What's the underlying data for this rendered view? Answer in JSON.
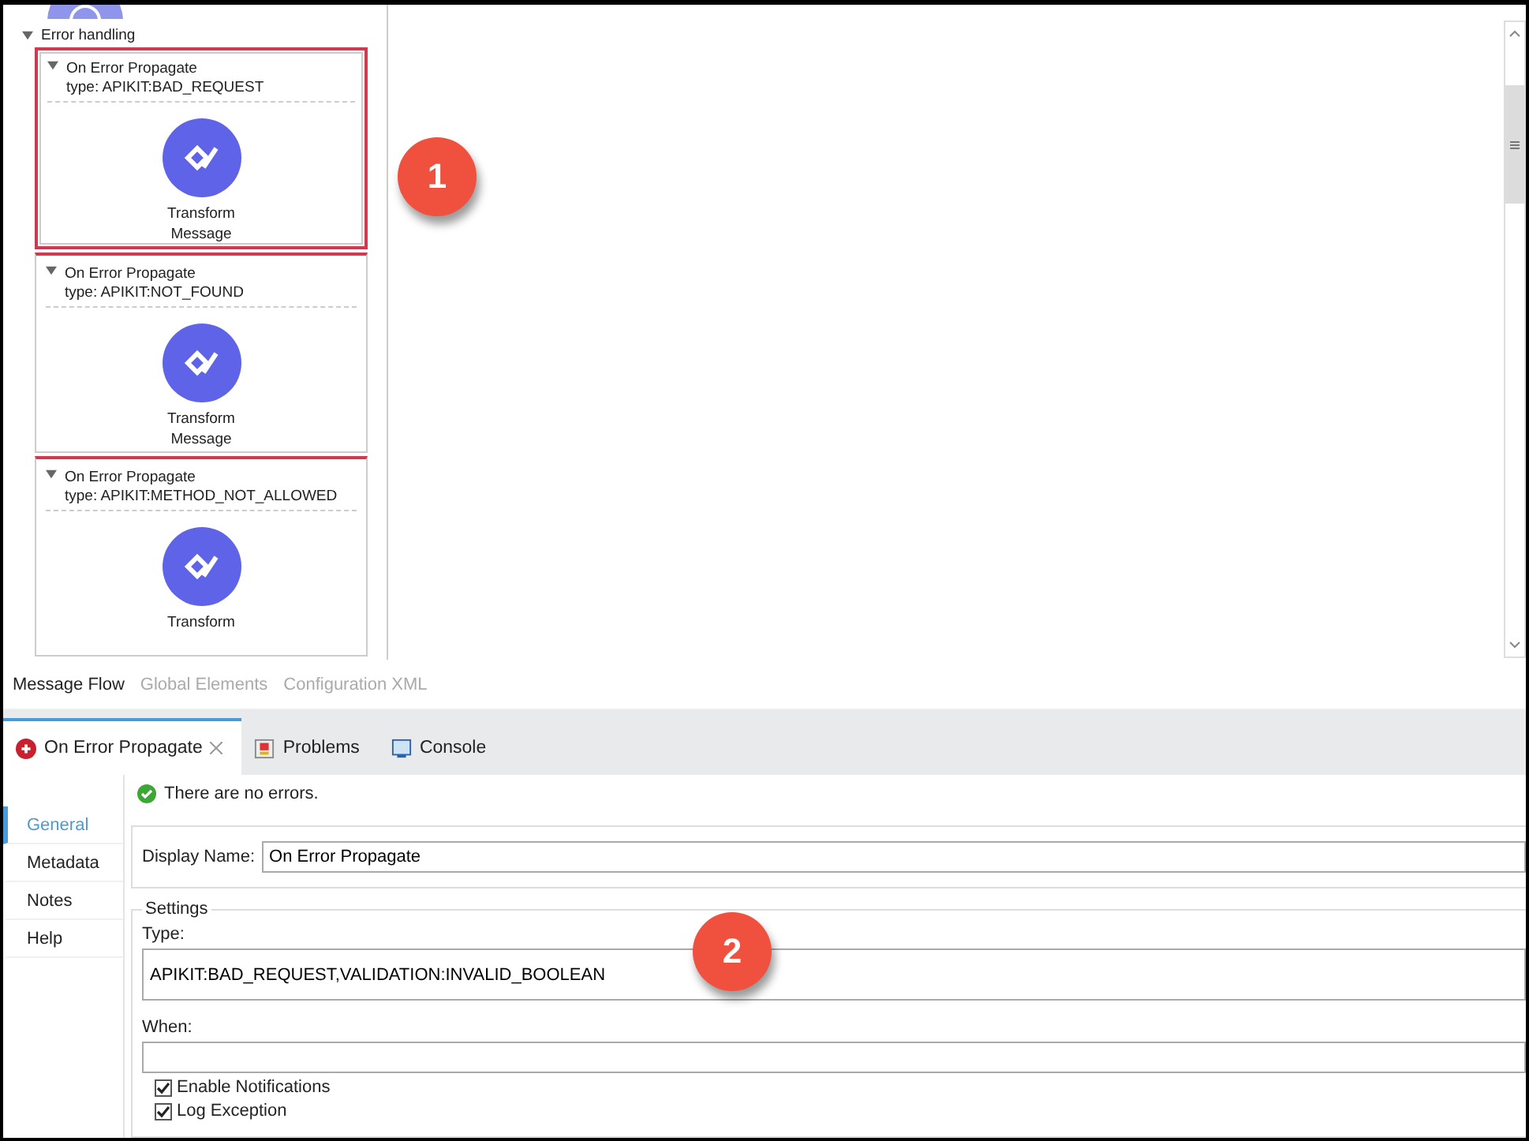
{
  "canvas": {
    "section": {
      "label": "Error handling",
      "expanded": true
    },
    "handlers": [
      {
        "title": "On Error Propagate",
        "type": "type: APIKIT:BAD_REQUEST",
        "selected": true,
        "component": [
          "Transform",
          "Message"
        ]
      },
      {
        "title": "On Error Propagate",
        "type": "type: APIKIT:NOT_FOUND",
        "selected": false,
        "component": [
          "Transform",
          "Message"
        ]
      },
      {
        "title": "On Error Propagate",
        "type": "type: APIKIT:METHOD_NOT_ALLOWED",
        "selected": false,
        "component": [
          "Transform"
        ]
      }
    ]
  },
  "callouts": [
    "1",
    "2"
  ],
  "editor_tabs": [
    {
      "label": "Message Flow",
      "selected": true
    },
    {
      "label": "Global Elements",
      "selected": false
    },
    {
      "label": "Configuration XML",
      "selected": false
    }
  ],
  "view_tabs": [
    {
      "label": "On Error Propagate",
      "kind": "error",
      "selected": true
    },
    {
      "label": "Problems",
      "kind": "problems",
      "selected": false
    },
    {
      "label": "Console",
      "kind": "console",
      "selected": false
    }
  ],
  "properties": {
    "status": "There are no errors.",
    "nav": [
      {
        "label": "General",
        "selected": true
      },
      {
        "label": "Metadata",
        "selected": false
      },
      {
        "label": "Notes",
        "selected": false
      },
      {
        "label": "Help",
        "selected": false
      }
    ],
    "display_name": {
      "label": "Display Name:",
      "value": "On Error Propagate"
    },
    "settings": {
      "legend": "Settings",
      "type": {
        "label": "Type:",
        "value": "APIKIT:BAD_REQUEST,VALIDATION:INVALID_BOOLEAN"
      },
      "when": {
        "label": "When:"
      },
      "checkboxes": [
        {
          "label": "Enable Notifications",
          "checked": true
        },
        {
          "label": "Log Exception",
          "checked": true
        }
      ]
    }
  }
}
